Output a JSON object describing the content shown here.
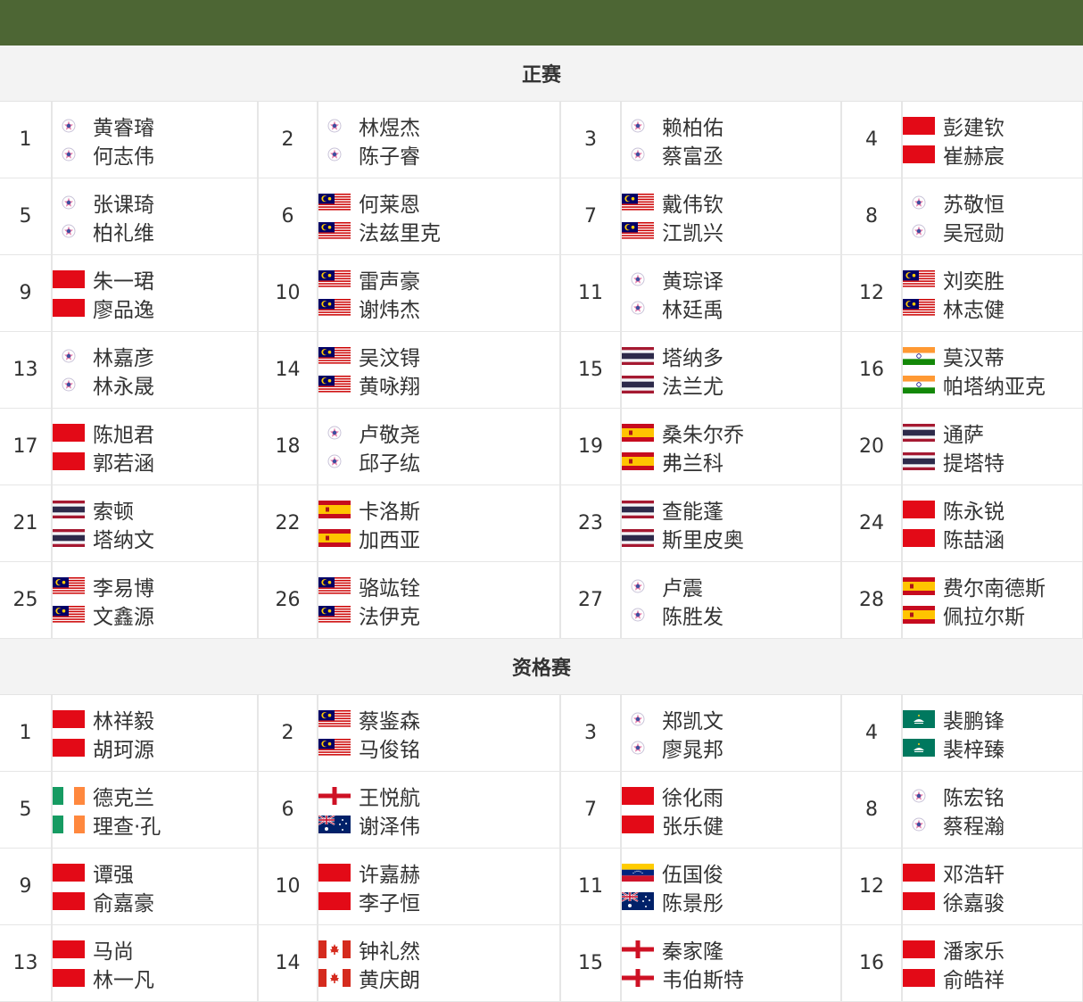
{
  "sections": [
    {
      "title": "正赛",
      "pairs": [
        {
          "seed": "1",
          "players": [
            {
              "name": "黄睿璿",
              "flag": "tpe"
            },
            {
              "name": "何志伟",
              "flag": "tpe"
            }
          ]
        },
        {
          "seed": "2",
          "players": [
            {
              "name": "林煜杰",
              "flag": "tpe"
            },
            {
              "name": "陈子睿",
              "flag": "tpe"
            }
          ]
        },
        {
          "seed": "3",
          "players": [
            {
              "name": "赖柏佑",
              "flag": "tpe"
            },
            {
              "name": "蔡富丞",
              "flag": "tpe"
            }
          ]
        },
        {
          "seed": "4",
          "players": [
            {
              "name": "彭建钦",
              "flag": "chn"
            },
            {
              "name": "崔赫宸",
              "flag": "chn"
            }
          ]
        },
        {
          "seed": "5",
          "players": [
            {
              "name": "张课琦",
              "flag": "tpe"
            },
            {
              "name": "柏礼维",
              "flag": "tpe"
            }
          ]
        },
        {
          "seed": "6",
          "players": [
            {
              "name": "何莱恩",
              "flag": "mas"
            },
            {
              "name": "法兹里克",
              "flag": "mas"
            }
          ]
        },
        {
          "seed": "7",
          "players": [
            {
              "name": "戴伟钦",
              "flag": "mas"
            },
            {
              "name": "江凯兴",
              "flag": "mas"
            }
          ]
        },
        {
          "seed": "8",
          "players": [
            {
              "name": "苏敬恒",
              "flag": "tpe"
            },
            {
              "name": "吴冠勋",
              "flag": "tpe"
            }
          ]
        },
        {
          "seed": "9",
          "players": [
            {
              "name": "朱一珺",
              "flag": "chn"
            },
            {
              "name": "廖品逸",
              "flag": "chn"
            }
          ]
        },
        {
          "seed": "10",
          "players": [
            {
              "name": "雷声豪",
              "flag": "mas"
            },
            {
              "name": "谢炜杰",
              "flag": "mas"
            }
          ]
        },
        {
          "seed": "11",
          "players": [
            {
              "name": "黄琮译",
              "flag": "tpe"
            },
            {
              "name": "林廷禹",
              "flag": "tpe"
            }
          ]
        },
        {
          "seed": "12",
          "players": [
            {
              "name": "刘奕胜",
              "flag": "mas"
            },
            {
              "name": "林志健",
              "flag": "mas"
            }
          ]
        },
        {
          "seed": "13",
          "players": [
            {
              "name": "林嘉彦",
              "flag": "tpe"
            },
            {
              "name": "林永晟",
              "flag": "tpe"
            }
          ]
        },
        {
          "seed": "14",
          "players": [
            {
              "name": "吴汶锝",
              "flag": "mas"
            },
            {
              "name": "黄咏翔",
              "flag": "mas"
            }
          ]
        },
        {
          "seed": "15",
          "players": [
            {
              "name": "塔纳多",
              "flag": "tha"
            },
            {
              "name": "法兰尤",
              "flag": "tha"
            }
          ]
        },
        {
          "seed": "16",
          "players": [
            {
              "name": "莫汉蒂",
              "flag": "ind"
            },
            {
              "name": "帕塔纳亚克",
              "flag": "ind"
            }
          ]
        },
        {
          "seed": "17",
          "players": [
            {
              "name": "陈旭君",
              "flag": "chn"
            },
            {
              "name": "郭若涵",
              "flag": "chn"
            }
          ]
        },
        {
          "seed": "18",
          "players": [
            {
              "name": "卢敬尧",
              "flag": "tpe"
            },
            {
              "name": "邱子纮",
              "flag": "tpe"
            }
          ]
        },
        {
          "seed": "19",
          "players": [
            {
              "name": "桑朱尔乔",
              "flag": "esp"
            },
            {
              "name": "弗兰科",
              "flag": "esp"
            }
          ]
        },
        {
          "seed": "20",
          "players": [
            {
              "name": "通萨",
              "flag": "tha"
            },
            {
              "name": "提塔特",
              "flag": "tha"
            }
          ]
        },
        {
          "seed": "21",
          "players": [
            {
              "name": "索顿",
              "flag": "tha"
            },
            {
              "name": "塔纳文",
              "flag": "tha"
            }
          ]
        },
        {
          "seed": "22",
          "players": [
            {
              "name": "卡洛斯",
              "flag": "esp"
            },
            {
              "name": "加西亚",
              "flag": "esp"
            }
          ]
        },
        {
          "seed": "23",
          "players": [
            {
              "name": "查能蓬",
              "flag": "tha"
            },
            {
              "name": "斯里皮奥",
              "flag": "tha"
            }
          ]
        },
        {
          "seed": "24",
          "players": [
            {
              "name": "陈永锐",
              "flag": "chn"
            },
            {
              "name": "陈喆涵",
              "flag": "chn"
            }
          ]
        },
        {
          "seed": "25",
          "players": [
            {
              "name": "李易博",
              "flag": "mas"
            },
            {
              "name": "文鑫源",
              "flag": "mas"
            }
          ]
        },
        {
          "seed": "26",
          "players": [
            {
              "name": "骆竑铨",
              "flag": "mas"
            },
            {
              "name": "法伊克",
              "flag": "mas"
            }
          ]
        },
        {
          "seed": "27",
          "players": [
            {
              "name": "卢震",
              "flag": "tpe"
            },
            {
              "name": "陈胜发",
              "flag": "tpe"
            }
          ]
        },
        {
          "seed": "28",
          "players": [
            {
              "name": "费尔南德斯",
              "flag": "esp"
            },
            {
              "name": "佩拉尔斯",
              "flag": "esp"
            }
          ]
        }
      ]
    },
    {
      "title": "资格赛",
      "pairs": [
        {
          "seed": "1",
          "players": [
            {
              "name": "林祥毅",
              "flag": "chn"
            },
            {
              "name": "胡珂源",
              "flag": "chn"
            }
          ]
        },
        {
          "seed": "2",
          "players": [
            {
              "name": "蔡鉴森",
              "flag": "mas"
            },
            {
              "name": "马俊铭",
              "flag": "mas"
            }
          ]
        },
        {
          "seed": "3",
          "players": [
            {
              "name": "郑凯文",
              "flag": "tpe"
            },
            {
              "name": "廖晁邦",
              "flag": "tpe"
            }
          ]
        },
        {
          "seed": "4",
          "players": [
            {
              "name": "裴鹏锋",
              "flag": "mac"
            },
            {
              "name": "裴梓臻",
              "flag": "mac"
            }
          ]
        },
        {
          "seed": "5",
          "players": [
            {
              "name": "德克兰",
              "flag": "irl"
            },
            {
              "name": "理查·孔",
              "flag": "irl"
            }
          ]
        },
        {
          "seed": "6",
          "players": [
            {
              "name": "王悦航",
              "flag": "eng"
            },
            {
              "name": "谢泽伟",
              "flag": "aus"
            }
          ]
        },
        {
          "seed": "7",
          "players": [
            {
              "name": "徐化雨",
              "flag": "chn"
            },
            {
              "name": "张乐健",
              "flag": "chn"
            }
          ]
        },
        {
          "seed": "8",
          "players": [
            {
              "name": "陈宏铭",
              "flag": "tpe"
            },
            {
              "name": "蔡程瀚",
              "flag": "tpe"
            }
          ]
        },
        {
          "seed": "9",
          "players": [
            {
              "name": "谭强",
              "flag": "chn"
            },
            {
              "name": "俞嘉豪",
              "flag": "chn"
            }
          ]
        },
        {
          "seed": "10",
          "players": [
            {
              "name": "许嘉赫",
              "flag": "chn"
            },
            {
              "name": "李子恒",
              "flag": "chn"
            }
          ]
        },
        {
          "seed": "11",
          "players": [
            {
              "name": "伍国俊",
              "flag": "ven"
            },
            {
              "name": "陈景彤",
              "flag": "aus"
            }
          ]
        },
        {
          "seed": "12",
          "players": [
            {
              "name": "邓浩轩",
              "flag": "chn"
            },
            {
              "name": "徐嘉骏",
              "flag": "chn"
            }
          ]
        },
        {
          "seed": "13",
          "players": [
            {
              "name": "马尚",
              "flag": "chn"
            },
            {
              "name": "林一凡",
              "flag": "chn"
            }
          ]
        },
        {
          "seed": "14",
          "players": [
            {
              "name": "钟礼然",
              "flag": "can"
            },
            {
              "name": "黄庆朗",
              "flag": "can"
            }
          ]
        },
        {
          "seed": "15",
          "players": [
            {
              "name": "秦家隆",
              "flag": "eng"
            },
            {
              "name": "韦伯斯特",
              "flag": "eng"
            }
          ]
        },
        {
          "seed": "16",
          "players": [
            {
              "name": "潘家乐",
              "flag": "chn"
            },
            {
              "name": "俞皓祥",
              "flag": "chn"
            }
          ]
        }
      ]
    }
  ],
  "colors": {
    "header_bar": "#4d6634",
    "section_bg": "#f3f3f3"
  }
}
